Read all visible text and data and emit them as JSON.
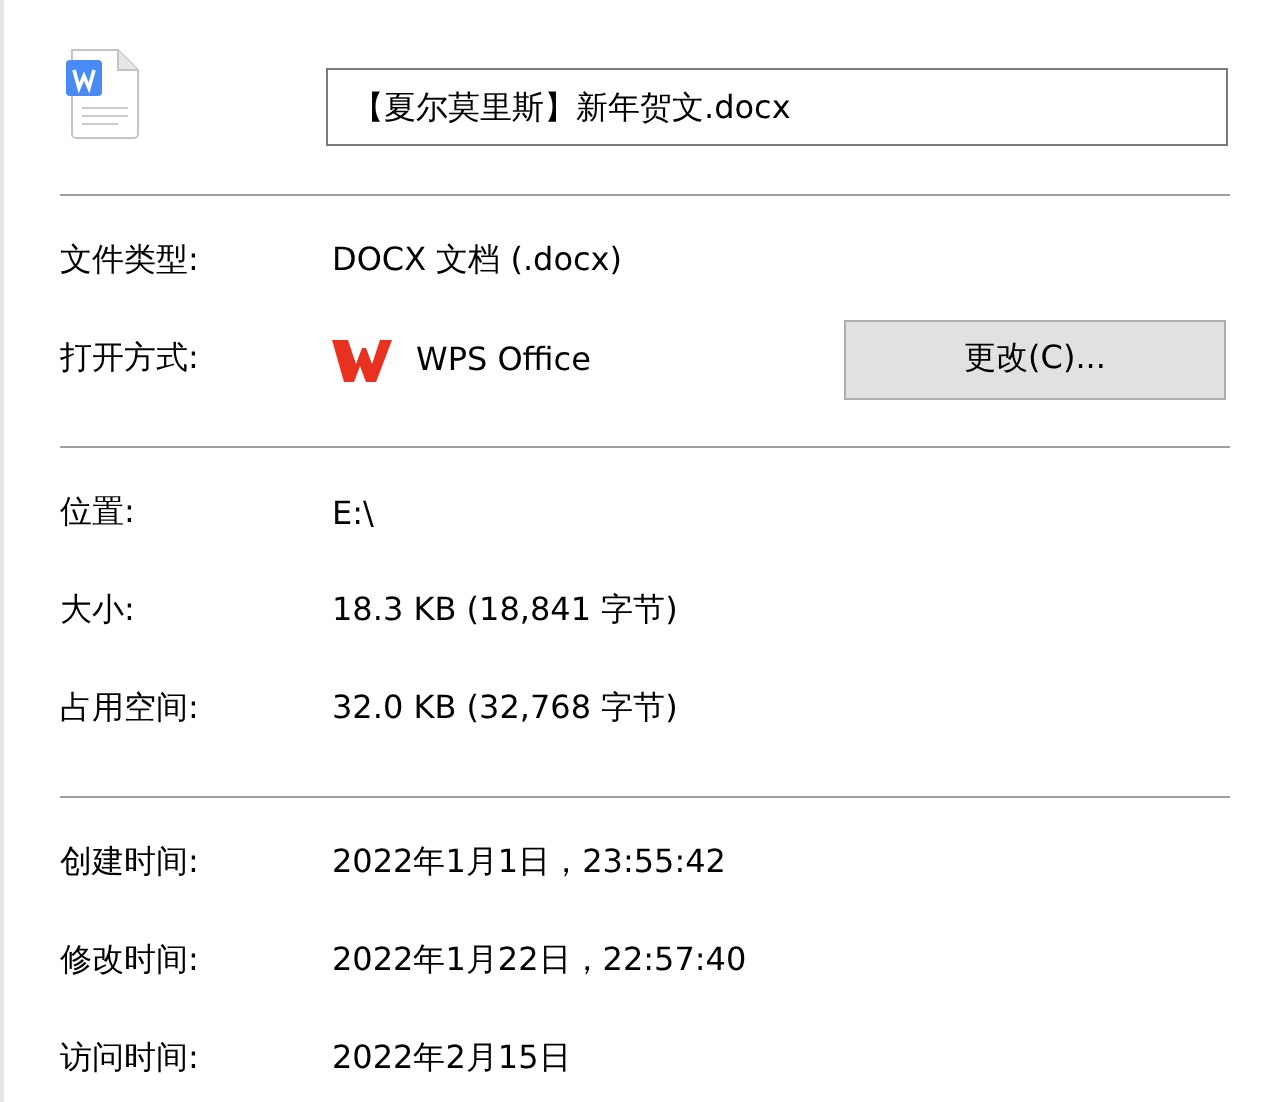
{
  "file_name": "【夏尔莫里斯】新年贺文.docx",
  "type_section": [
    {
      "label": "文件类型:",
      "value": "DOCX 文档 (.docx)",
      "kind": "text"
    },
    {
      "label": "打开方式:",
      "value": "WPS Office",
      "kind": "app",
      "button": "更改(C)..."
    }
  ],
  "location_section": [
    {
      "label": "位置:",
      "value": "E:\\",
      "kind": "text"
    },
    {
      "label": "大小:",
      "value": "18.3 KB (18,841 字节)",
      "kind": "text"
    },
    {
      "label": "占用空间:",
      "value": "32.0 KB (32,768 字节)",
      "kind": "text"
    }
  ],
  "time_section": [
    {
      "label": "创建时间:",
      "value": "2022年1月1日，23:55:42",
      "kind": "text"
    },
    {
      "label": "修改时间:",
      "value": "2022年1月22日，22:57:40",
      "kind": "text"
    },
    {
      "label": "访问时间:",
      "value": "2022年2月15日",
      "kind": "text"
    }
  ]
}
